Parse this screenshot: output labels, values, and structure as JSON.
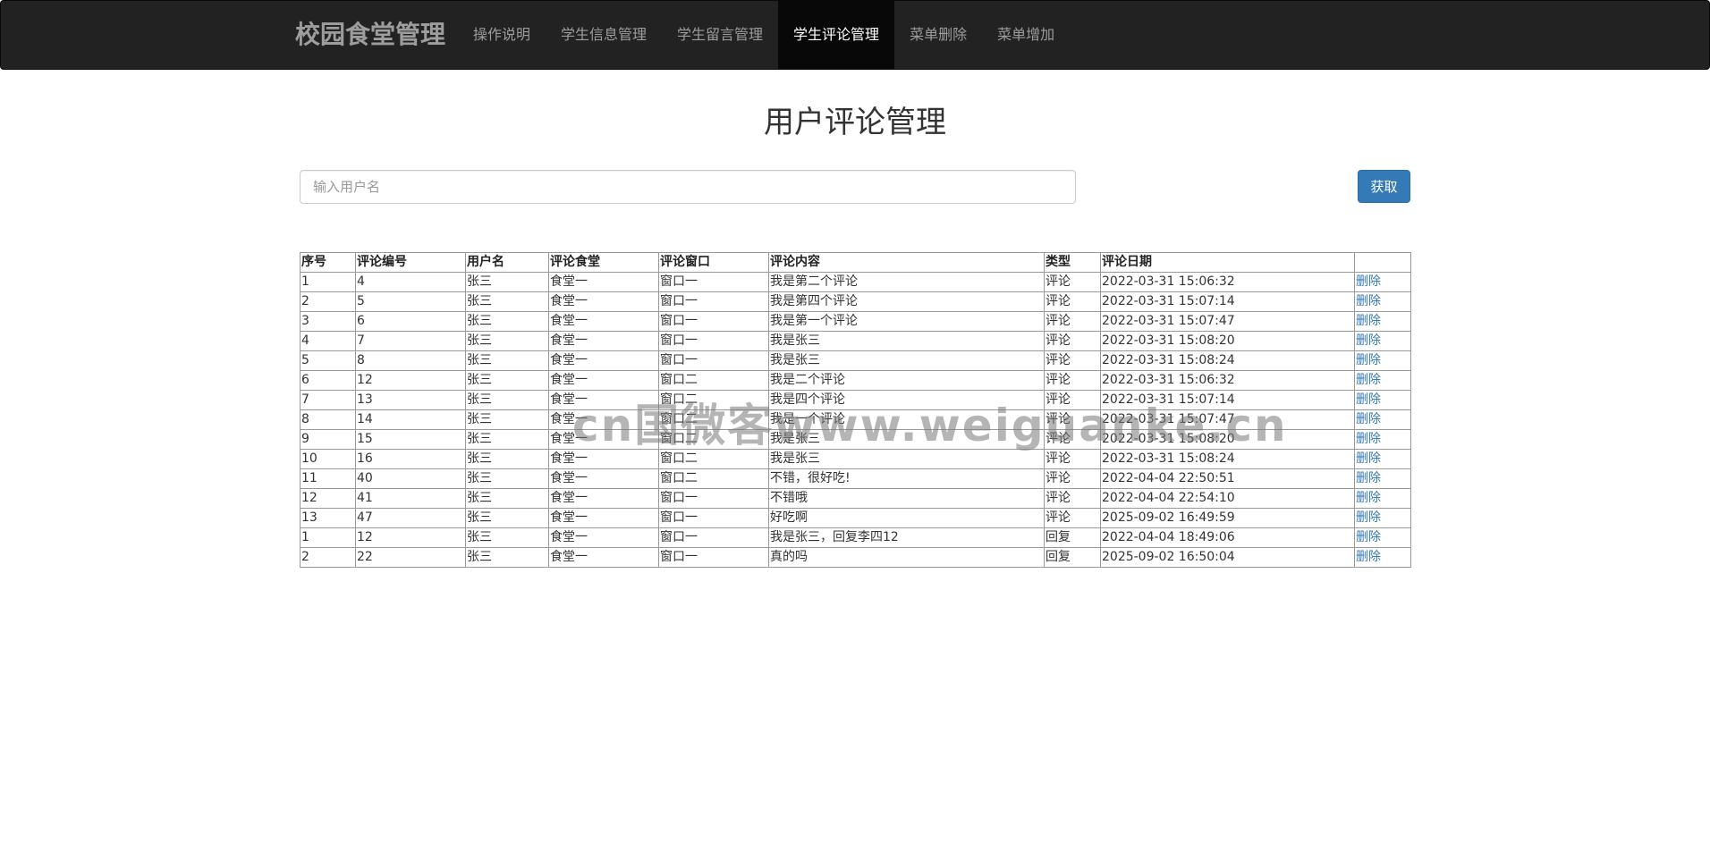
{
  "navbar": {
    "brand": "校园食堂管理",
    "items": [
      {
        "label": "操作说明",
        "active": false
      },
      {
        "label": "学生信息管理",
        "active": false
      },
      {
        "label": "学生留言管理",
        "active": false
      },
      {
        "label": "学生评论管理",
        "active": true
      },
      {
        "label": "菜单删除",
        "active": false
      },
      {
        "label": "菜单增加",
        "active": false
      }
    ]
  },
  "page": {
    "title": "用户评论管理"
  },
  "search": {
    "value": "",
    "placeholder": "输入用户名",
    "button_label": "获取"
  },
  "table": {
    "headers": [
      "序号",
      "评论编号",
      "用户名",
      "评论食堂",
      "评论窗口",
      "评论内容",
      "类型",
      "评论日期",
      ""
    ],
    "delete_label": "删除",
    "rows": [
      [
        "1",
        "4",
        "张三",
        "食堂一",
        "窗口一",
        "我是第二个评论",
        "评论",
        "2022-03-31 15:06:32"
      ],
      [
        "2",
        "5",
        "张三",
        "食堂一",
        "窗口一",
        "我是第四个评论",
        "评论",
        "2022-03-31 15:07:14"
      ],
      [
        "3",
        "6",
        "张三",
        "食堂一",
        "窗口一",
        "我是第一个评论",
        "评论",
        "2022-03-31 15:07:47"
      ],
      [
        "4",
        "7",
        "张三",
        "食堂一",
        "窗口一",
        "我是张三",
        "评论",
        "2022-03-31 15:08:20"
      ],
      [
        "5",
        "8",
        "张三",
        "食堂一",
        "窗口一",
        "我是张三",
        "评论",
        "2022-03-31 15:08:24"
      ],
      [
        "6",
        "12",
        "张三",
        "食堂一",
        "窗口二",
        "我是二个评论",
        "评论",
        "2022-03-31 15:06:32"
      ],
      [
        "7",
        "13",
        "张三",
        "食堂一",
        "窗口二",
        "我是四个评论",
        "评论",
        "2022-03-31 15:07:14"
      ],
      [
        "8",
        "14",
        "张三",
        "食堂一",
        "窗口二",
        "我是一个评论",
        "评论",
        "2022-03-31 15:07:47"
      ],
      [
        "9",
        "15",
        "张三",
        "食堂一",
        "窗口二",
        "我是张三",
        "评论",
        "2022-03-31 15:08:20"
      ],
      [
        "10",
        "16",
        "张三",
        "食堂一",
        "窗口二",
        "我是张三",
        "评论",
        "2022-03-31 15:08:24"
      ],
      [
        "11",
        "40",
        "张三",
        "食堂一",
        "窗口二",
        "不错，很好吃!",
        "评论",
        "2022-04-04 22:50:51"
      ],
      [
        "12",
        "41",
        "张三",
        "食堂一",
        "窗口一",
        "不错哦",
        "评论",
        "2022-04-04 22:54:10"
      ],
      [
        "13",
        "47",
        "张三",
        "食堂一",
        "窗口一",
        "好吃啊",
        "评论",
        "2025-09-02 16:49:59"
      ],
      [
        "1",
        "12",
        "张三",
        "食堂一",
        "窗口一",
        "我是张三，回复李四12",
        "回复",
        "2022-04-04 18:49:06"
      ],
      [
        "2",
        "22",
        "张三",
        "食堂一",
        "窗口一",
        "真的吗",
        "回复",
        "2025-09-02 16:50:04"
      ]
    ]
  },
  "watermark": "cn国微客www.weiguanke.cn"
}
